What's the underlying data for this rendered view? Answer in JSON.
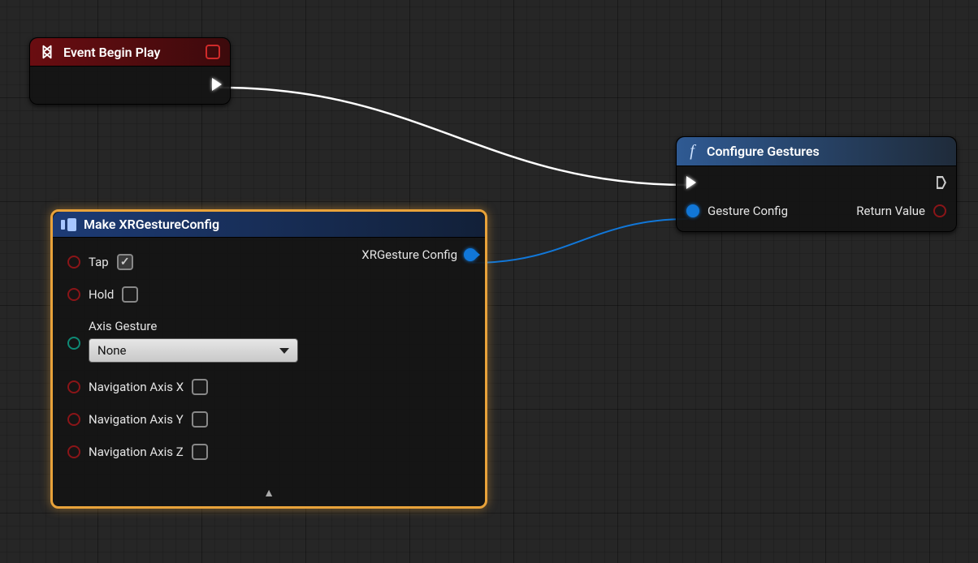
{
  "event_node": {
    "title": "Event Begin Play"
  },
  "struct_node": {
    "title": "Make XRGestureConfig",
    "output_label": "XRGesture Config",
    "fields": {
      "tap": {
        "label": "Tap",
        "checked": true
      },
      "hold": {
        "label": "Hold",
        "checked": false
      },
      "axis_gesture": {
        "label": "Axis Gesture",
        "value": "None"
      },
      "nav_x": {
        "label": "Navigation Axis X",
        "checked": false
      },
      "nav_y": {
        "label": "Navigation Axis Y",
        "checked": false
      },
      "nav_z": {
        "label": "Navigation Axis Z",
        "checked": false
      }
    }
  },
  "func_node": {
    "title": "Configure Gestures",
    "input_label": "Gesture Config",
    "output_label": "Return Value"
  }
}
